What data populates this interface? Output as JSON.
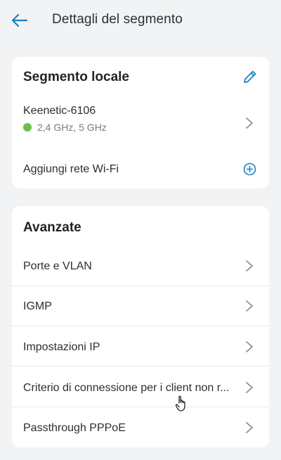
{
  "header": {
    "title": "Dettagli del segmento"
  },
  "local_segment": {
    "title": "Segmento locale",
    "network": {
      "name": "Keenetic-6106",
      "bands": "2,4 GHz, 5 GHz",
      "status_color": "#6cbf4a"
    },
    "add_wifi_label": "Aggiungi rete Wi-Fi"
  },
  "advanced": {
    "title": "Avanzate",
    "items": [
      {
        "label": "Porte e VLAN"
      },
      {
        "label": "IGMP"
      },
      {
        "label": "Impostazioni IP"
      },
      {
        "label": "Criterio di connessione per i client non r..."
      },
      {
        "label": "Passthrough PPPoE"
      }
    ]
  },
  "colors": {
    "accent": "#1a7fc1",
    "background": "#f2f3f5",
    "card": "#ffffff"
  }
}
